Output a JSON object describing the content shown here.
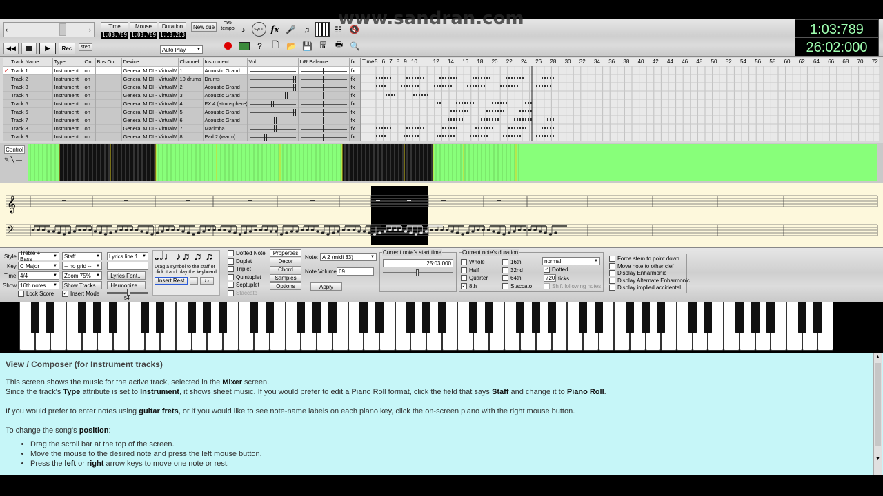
{
  "watermark": "www.sandran.com",
  "time_display": {
    "current": "1:03:789",
    "total": "26:02:000"
  },
  "transport": {
    "headers": [
      "Time",
      "Mouse",
      "Duration"
    ],
    "values": [
      "1:03.789",
      "1:03.789",
      "1:13.263"
    ],
    "new_cue": "New cue",
    "rec": "Rec",
    "step": "step",
    "auto_play": "Auto Play",
    "tempo_label": "=95\ntempo",
    "sync": "sync",
    "fx": "fx"
  },
  "track_table": {
    "headers": [
      "Track Name",
      "Type",
      "On",
      "Bus Out",
      "Device",
      "Channel",
      "Instrument",
      "Vol",
      "L/R Balance",
      "fx",
      "Time"
    ],
    "rows": [
      {
        "name": "Track 1",
        "type": "Instrument",
        "on": "on",
        "device": "General MIDI - VirtualM",
        "channel": "1",
        "instrument": "Acoustic Grand",
        "fx": "fx",
        "checked": true
      },
      {
        "name": "Track 2",
        "type": "Instrument",
        "on": "on",
        "device": "General MIDI - VirtualM",
        "channel": "10 drums",
        "instrument": "Drums",
        "fx": "fx"
      },
      {
        "name": "Track 3",
        "type": "Instrument",
        "on": "on",
        "device": "General MIDI - VirtualM",
        "channel": "2",
        "instrument": "Acoustic Grand",
        "fx": "fx"
      },
      {
        "name": "Track 4",
        "type": "Instrument",
        "on": "on",
        "device": "General MIDI - VirtualM",
        "channel": "3",
        "instrument": "Acoustic Grand",
        "fx": "fx"
      },
      {
        "name": "Track 5",
        "type": "Instrument",
        "on": "on",
        "device": "General MIDI - VirtualM",
        "channel": "4",
        "instrument": "FX 4 (atmosphere)",
        "fx": "fx"
      },
      {
        "name": "Track 6",
        "type": "Instrument",
        "on": "on",
        "device": "General MIDI - VirtualM",
        "channel": "5",
        "instrument": "Acoustic Grand",
        "fx": "fx"
      },
      {
        "name": "Track 7",
        "type": "Instrument",
        "on": "on",
        "device": "General MIDI - VirtualM",
        "channel": "6",
        "instrument": "Acoustic Grand",
        "fx": "fx"
      },
      {
        "name": "Track 8",
        "type": "Instrument",
        "on": "on",
        "device": "General MIDI - VirtualM",
        "channel": "7",
        "instrument": "Marimba",
        "fx": "fx"
      },
      {
        "name": "Track 9",
        "type": "Instrument",
        "on": "on",
        "device": "General MIDI - VirtualM",
        "channel": "8",
        "instrument": "Pad 2 (warm)",
        "fx": "fx"
      }
    ],
    "timeline_ticks": [
      "5",
      "6",
      "7",
      "8",
      "9",
      "10",
      "12",
      "14",
      "16",
      "18",
      "20",
      "22",
      "24",
      "26",
      "28",
      "30",
      "32",
      "34",
      "36",
      "38",
      "40",
      "42",
      "44",
      "46",
      "48",
      "50",
      "52",
      "54",
      "56",
      "58",
      "60",
      "62",
      "64",
      "66",
      "68",
      "70",
      "72"
    ]
  },
  "control_button": "Control",
  "panel": {
    "style_label": "Style",
    "style_value": "Treble + Bass",
    "key_label": "Key",
    "key_value": "C Major",
    "time_label": "Time",
    "time_value": "4/4",
    "show_label": "Show",
    "show_value": "16th notes",
    "staff_value": "Staff",
    "grid_value": "-- no grid --",
    "zoom_value": "Zoom 75%",
    "show_tracks": "Show Tracks...",
    "lyrics_value": "Lyrics line 1",
    "lyrics_font": "Lyrics Font...",
    "harmonize": "Harmonize...",
    "lock_score": "Lock Score",
    "insert_mode": "Insert Mode",
    "slider_value": "54",
    "drag_hint": "Drag a symbol to the staff or click it and play the keyboard",
    "insert_rest": "Insert Rest",
    "more": "...",
    "note_options": [
      "Dotted Note",
      "Duplet",
      "Triplet",
      "Quintuplet",
      "Septuplet",
      "Staccato"
    ],
    "tabs": [
      "Properties",
      "Decor",
      "Chord",
      "Samples",
      "Options"
    ],
    "note_label": "Note:",
    "note_value": "A 2 (midi 33)",
    "note_volume_label": "Note Volume:",
    "note_volume_value": "69",
    "apply": "Apply",
    "start_time_title": "Current note's start time",
    "start_time_value": "25:03:000",
    "duration_title": "Current note's duration",
    "durations_col1": [
      "Whole",
      "Half",
      "Quarter",
      "8th"
    ],
    "durations_col2": [
      "16th",
      "32nd",
      "64th",
      "Staccato"
    ],
    "duration_mode": "normal",
    "dotted": "Dotted",
    "ticks_value": "720",
    "ticks_label": "ticks",
    "shift_following": "Shift following notes",
    "right_options": [
      "Force stem to point down",
      "Move note to other clef",
      "Display Enharmonic",
      "Display Alternate Enharmonic",
      "Display implied accidental"
    ]
  },
  "help": {
    "title": "View / Composer (for Instrument tracks)",
    "p1a": "This screen shows the music for the active track, selected in the ",
    "p1b": "Mixer",
    "p1c": " screen.",
    "p2a": "Since the track's ",
    "p2b": "Type",
    "p2c": " attribute is set to ",
    "p2d": "Instrument",
    "p2e": ", it shows sheet music. If you would prefer to edit a Piano Roll format, click the field that says ",
    "p2f": "Staff",
    "p2g": " and change it to ",
    "p2h": "Piano Roll",
    "p2i": ".",
    "p3a": "If you would prefer to enter notes using ",
    "p3b": "guitar frets",
    "p3c": ", or if you would like to see note-name labels on each piano key, click the on-screen piano with the right mouse button.",
    "p4a": "To change the song's ",
    "p4b": "position",
    "p4c": ":",
    "bullets": [
      "Drag the scroll bar at the top of the screen.",
      "Move the mouse to the desired note and press the left mouse button."
    ],
    "b3a": "Press the ",
    "b3b": "left",
    "b3c": " or ",
    "b3d": "right",
    "b3e": " arrow keys to move one note or rest."
  },
  "colors": {
    "accent_green": "#88ff7a",
    "help_bg": "#c6f6f8",
    "staff_bg": "#fdf8dc",
    "lcd_text": "#9fffb0"
  }
}
